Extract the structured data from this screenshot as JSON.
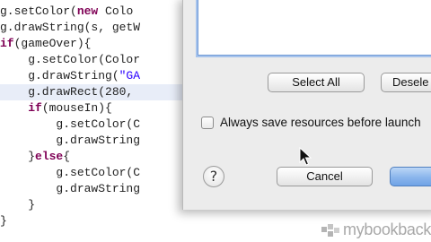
{
  "editor": {
    "lines": [
      {
        "parts": [
          {
            "t": "g.setColor("
          },
          {
            "t": "new",
            "c": "kw"
          },
          {
            "t": " Colo"
          }
        ]
      },
      {
        "parts": [
          {
            "t": "g.drawString(s, getW"
          }
        ]
      },
      {
        "parts": [
          {
            "t": "if",
            "c": "kw"
          },
          {
            "t": "(gameOver){"
          }
        ]
      },
      {
        "parts": [
          {
            "t": "    g.setColor(Color"
          }
        ]
      },
      {
        "parts": [
          {
            "t": "    g.drawString("
          },
          {
            "t": "\"GA",
            "c": "str"
          }
        ]
      },
      {
        "parts": [
          {
            "t": "    g.drawRect(280, "
          }
        ]
      },
      {
        "parts": [
          {
            "t": "    "
          },
          {
            "t": "if",
            "c": "kw"
          },
          {
            "t": "(mouseIn){"
          }
        ]
      },
      {
        "parts": [
          {
            "t": "        g.setColor(C"
          }
        ]
      },
      {
        "parts": [
          {
            "t": "        g.drawString"
          }
        ]
      },
      {
        "parts": [
          {
            "t": "    }"
          },
          {
            "t": "else",
            "c": "kw"
          },
          {
            "t": "{"
          }
        ]
      },
      {
        "parts": [
          {
            "t": "        g.setColor(C"
          }
        ]
      },
      {
        "parts": [
          {
            "t": "        g.drawString"
          }
        ]
      },
      {
        "parts": [
          {
            "t": "    }"
          }
        ]
      },
      {
        "parts": [
          {
            "t": "}"
          }
        ]
      }
    ],
    "highlighted_line": 5
  },
  "dialog": {
    "select_all_label": "Select All",
    "deselect_label": "Desele",
    "save_checkbox_label": "Always save resources before launch",
    "save_checkbox_checked": false,
    "help_glyph": "?",
    "cancel_label": "Cancel",
    "ok_label": ""
  },
  "watermark": {
    "brand_text": "mybookbackup",
    "icon": "brand-logo-icon"
  },
  "colors": {
    "keyword": "#7f0055",
    "string": "#2a00ff",
    "dialog_bg": "#ececec",
    "focus_ring": "#a6c3ec"
  }
}
